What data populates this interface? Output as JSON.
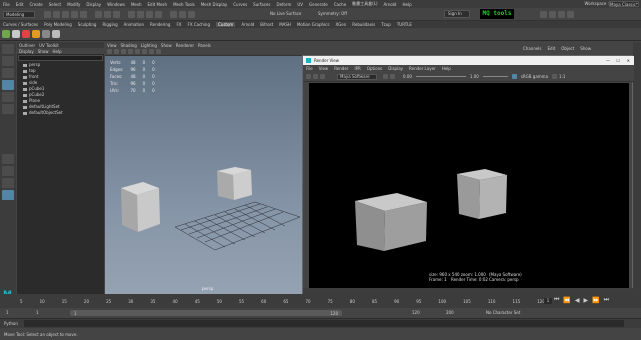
{
  "app": {
    "menus": [
      "File",
      "Edit",
      "Create",
      "Select",
      "Modify",
      "Display",
      "Windows",
      "Mesh",
      "Edit Mesh",
      "Mesh Tools",
      "Mesh Display",
      "Curves",
      "Surfaces",
      "Deform",
      "UV",
      "Generate",
      "Cache",
      "動畫工具盒(L)",
      "Arnold",
      "Help"
    ],
    "workspace_label": "Workspace :",
    "workspace_value": "Maya Classic*"
  },
  "statusline": {
    "mode": "Modeling",
    "no_live_surface": "No Live Surface",
    "symmetry": "Symmetry: Off",
    "sign_in": "Sign In",
    "logo_text": "MQ tools"
  },
  "shelf": {
    "tabs": [
      "Curves / Surfaces",
      "Poly Modeling",
      "Sculpting",
      "Rigging",
      "Animation",
      "Rendering",
      "FX",
      "FX Caching",
      "Custom",
      "Arnold",
      "Bifrost",
      "MASH",
      "Motion Graphics",
      "XGen",
      "Rebuildaxis",
      "Tzup",
      "TURTLE"
    ],
    "active_tab": "Custom"
  },
  "outliner": {
    "tabs": [
      "Outliner",
      "UV Toolkit"
    ],
    "menus": [
      "Display",
      "Show",
      "Help"
    ],
    "items": [
      {
        "label": "persp",
        "icon": "camera-icon"
      },
      {
        "label": "top",
        "icon": "camera-icon"
      },
      {
        "label": "front",
        "icon": "camera-icon"
      },
      {
        "label": "side",
        "icon": "camera-icon"
      },
      {
        "label": "pCube1",
        "icon": "mesh-icon"
      },
      {
        "label": "pCube2",
        "icon": "mesh-icon"
      },
      {
        "label": "Plane",
        "icon": "mesh-icon"
      },
      {
        "label": "defaultLightSet",
        "icon": "set-icon"
      },
      {
        "label": "defaultObjectSet",
        "icon": "set-icon"
      }
    ]
  },
  "viewport": {
    "menus": [
      "View",
      "Shading",
      "Lighting",
      "Show",
      "Renderer",
      "Panels"
    ],
    "hud": [
      {
        "label": "Verts:",
        "v1": "48",
        "v2": "0",
        "v3": "0"
      },
      {
        "label": "Edges:",
        "v1": "96",
        "v2": "0",
        "v3": "0"
      },
      {
        "label": "Faces:",
        "v1": "48",
        "v2": "0",
        "v3": "0"
      },
      {
        "label": "Tris:",
        "v1": "96",
        "v2": "0",
        "v3": "0"
      },
      {
        "label": "UVs:",
        "v1": "70",
        "v2": "0",
        "v3": "0"
      }
    ],
    "camera_label": "persp"
  },
  "render_view": {
    "title": "Render View",
    "menus": [
      "File",
      "View",
      "Render",
      "IPR",
      "Options",
      "Display",
      "Render Layer",
      "Help"
    ],
    "renderer": "Maya Software",
    "gamma": "sRGB gamma",
    "exposure": "0.00",
    "gamma_value": "1.00",
    "zoom": "1:1",
    "size": "size: 960 x 540 zoom: 1.000",
    "frame": "Frame: 1",
    "render_time": "Render Time: 0:02",
    "renderer_info": "(Maya Software)",
    "camera": "Camera: persp"
  },
  "channel_box": {
    "tabs": [
      "Channels",
      "Edit",
      "Object",
      "Show"
    ]
  },
  "timeslider": {
    "ticks": [
      "5",
      "10",
      "15",
      "20",
      "25",
      "30",
      "35",
      "40",
      "45",
      "50",
      "55",
      "60",
      "65",
      "70",
      "75",
      "80",
      "85",
      "90",
      "95",
      "100",
      "105",
      "110",
      "115",
      "120"
    ],
    "current_frame": "1"
  },
  "rangebar": {
    "start": "1",
    "start2": "1",
    "range_left": "1",
    "range_right": "120",
    "end": "120",
    "end2": "200",
    "character_set": "No Character Set"
  },
  "mel": {
    "label": "Python"
  },
  "helpline": {
    "text": "Move Tool: Select an object to move."
  }
}
